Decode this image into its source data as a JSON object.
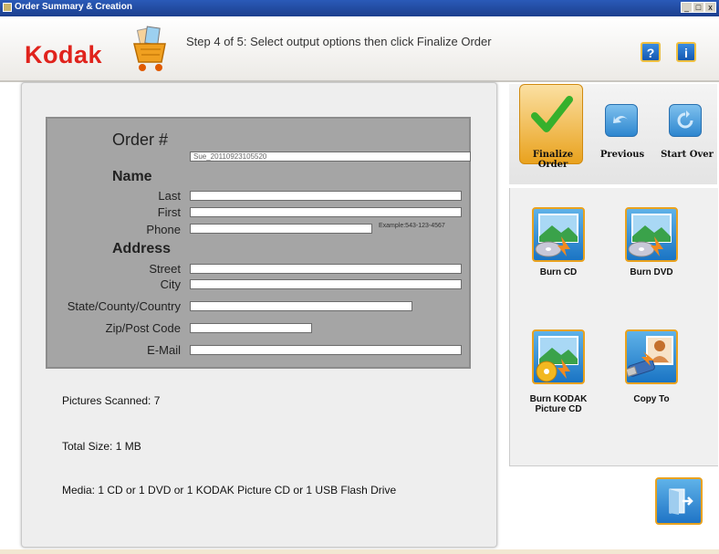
{
  "window": {
    "title": "Order Summary & Creation",
    "controls": [
      "_",
      "□",
      "x"
    ]
  },
  "header": {
    "brand": "Kodak",
    "step_text": "Step 4 of 5: Select output options then click Finalize Order",
    "help_label": "?",
    "info_label": "i"
  },
  "form": {
    "order_label": "Order #",
    "order_value": "Sue_20110923105520",
    "name_heading": "Name",
    "last_label": "Last",
    "first_label": "First",
    "phone_label": "Phone",
    "phone_example": "Example:543-123-4567",
    "address_heading": "Address",
    "street_label": "Street",
    "city_label": "City",
    "state_label": "State/County/Country",
    "zip_label": "Zip/Post Code",
    "email_label": "E-Mail"
  },
  "summary": {
    "pictures": "Pictures Scanned: 7",
    "size": "Total Size: 1 MB",
    "media": "Media: 1 CD or 1 DVD or 1 KODAK Picture CD or 1 USB Flash Drive"
  },
  "actions": {
    "finalize": "Finalize Order",
    "previous": "Previous",
    "start_over": "Start Over"
  },
  "outputs": {
    "burn_cd": "Burn CD",
    "burn_dvd": "Burn DVD",
    "burn_kodak": "Burn KODAK Picture CD",
    "copy_to": "Copy To"
  },
  "colors": {
    "brand": "#e0231c",
    "accent": "#e9a21e",
    "titlebar": "#1c3f8e"
  }
}
